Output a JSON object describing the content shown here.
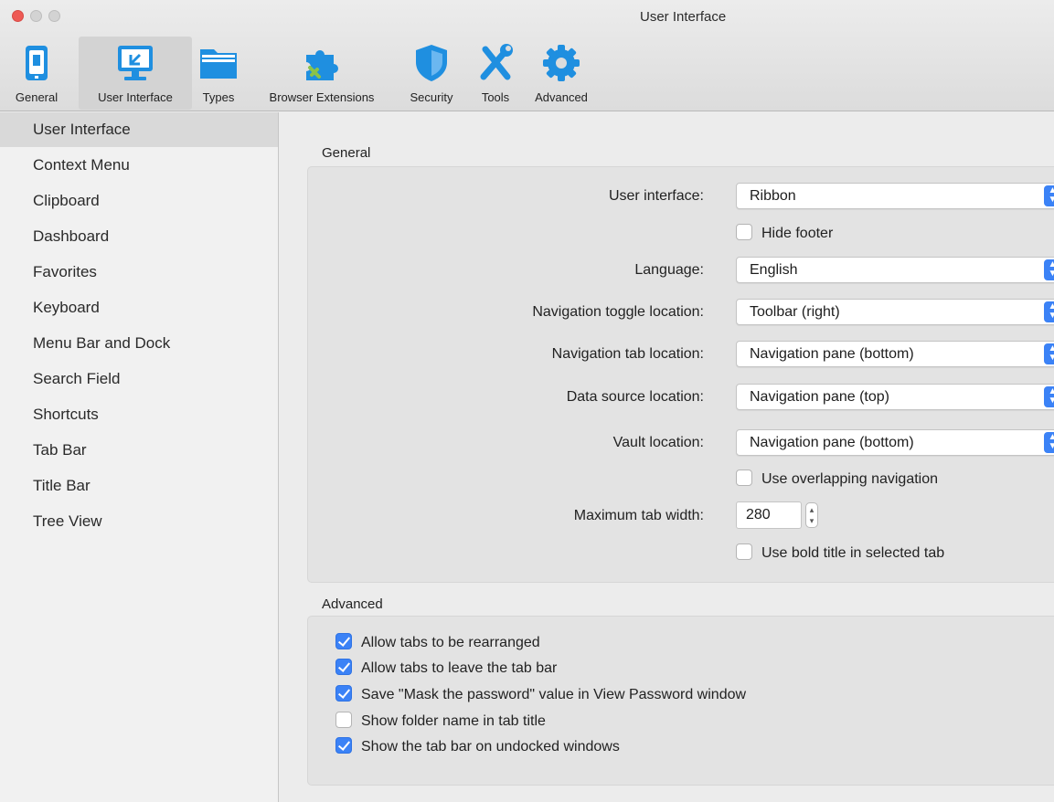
{
  "window": {
    "title": "User Interface"
  },
  "toolbar": {
    "items": [
      {
        "label": "General",
        "icon": "device-icon"
      },
      {
        "label": "User Interface",
        "icon": "monitor-icon",
        "active": true
      },
      {
        "label": "Types",
        "icon": "folder-icon"
      },
      {
        "label": "Browser Extensions",
        "icon": "puzzle-icon"
      },
      {
        "label": "Security",
        "icon": "shield-icon"
      },
      {
        "label": "Tools",
        "icon": "tools-icon"
      },
      {
        "label": "Advanced",
        "icon": "gear-icon"
      }
    ]
  },
  "sidebar": {
    "items": [
      {
        "label": "User Interface",
        "selected": true
      },
      {
        "label": "Context Menu"
      },
      {
        "label": "Clipboard"
      },
      {
        "label": "Dashboard"
      },
      {
        "label": "Favorites"
      },
      {
        "label": "Keyboard"
      },
      {
        "label": "Menu Bar and Dock"
      },
      {
        "label": "Search Field"
      },
      {
        "label": "Shortcuts"
      },
      {
        "label": "Tab Bar"
      },
      {
        "label": "Title Bar"
      },
      {
        "label": "Tree View"
      }
    ]
  },
  "general": {
    "title": "General",
    "user_interface": {
      "label": "User interface:",
      "value": "Ribbon"
    },
    "hide_footer": {
      "label": "Hide footer",
      "checked": false
    },
    "language": {
      "label": "Language:",
      "value": "English"
    },
    "nav_toggle": {
      "label": "Navigation toggle location:",
      "value": "Toolbar (right)"
    },
    "nav_tab": {
      "label": "Navigation tab location:",
      "value": "Navigation pane (bottom)"
    },
    "data_source": {
      "label": "Data source location:",
      "value": "Navigation pane (top)"
    },
    "vault": {
      "label": "Vault location:",
      "value": "Navigation pane (bottom)"
    },
    "overlapping": {
      "label": "Use overlapping navigation",
      "checked": false
    },
    "max_tab_width": {
      "label": "Maximum tab width:",
      "value": "280"
    },
    "bold_title": {
      "label": "Use bold title in selected tab",
      "checked": false
    }
  },
  "advanced": {
    "title": "Advanced",
    "options": [
      {
        "label": "Allow tabs to be rearranged",
        "checked": true
      },
      {
        "label": "Allow tabs to leave the tab bar",
        "checked": true
      },
      {
        "label": "Save \"Mask the password\" value in View Password window",
        "checked": true
      },
      {
        "label": "Show folder name in tab title",
        "checked": false
      },
      {
        "label": "Show the tab bar on undocked windows",
        "checked": true
      }
    ]
  },
  "colors": {
    "accent": "#3b82f6",
    "icon_blue": "#1f8fe0",
    "close": "#ee5a55"
  }
}
